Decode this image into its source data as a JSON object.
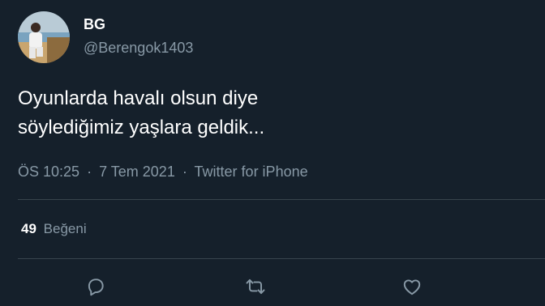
{
  "colors": {
    "background": "#15202b",
    "primary_text": "#ffffff",
    "secondary_text": "#8899a6",
    "divider": "#38444d"
  },
  "author": {
    "name": "BG",
    "handle": "@Berengok1403"
  },
  "tweet": {
    "lines": [
      "Oyunlarda havalı olsun diye",
      "söylediğimiz yaşlara geldik..."
    ]
  },
  "meta": {
    "time": "ÖS 10:25",
    "separator": "·",
    "date": "7 Tem 2021",
    "source": "Twitter for iPhone"
  },
  "stats": {
    "likes_count": "49",
    "likes_label": "Beğeni"
  },
  "actions": [
    {
      "icon": "reply-icon"
    },
    {
      "icon": "retweet-icon"
    },
    {
      "icon": "like-icon"
    }
  ]
}
